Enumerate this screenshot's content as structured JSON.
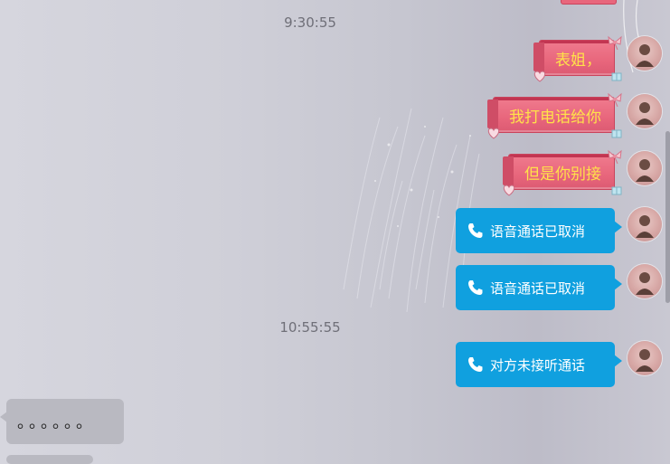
{
  "timestamps": [
    "9:30:55",
    "10:55:55"
  ],
  "messages": {
    "m1": "表姐，",
    "m2": "我打电话给你",
    "m3": "但是你别接",
    "call1": "语音通话已取消",
    "call2": "语音通话已取消",
    "call3": "对方未接听通话",
    "incoming": "。。。。。。"
  },
  "icons": {
    "phone": "phone-icon",
    "avatar": "avatar",
    "bow": "bow-icon",
    "heart": "heart-icon"
  },
  "colors": {
    "pink_bubble": "#e8667c",
    "pink_text": "#ffe14a",
    "blue_bubble": "#10a0df",
    "gray_bubble": "#b9b9c1"
  }
}
